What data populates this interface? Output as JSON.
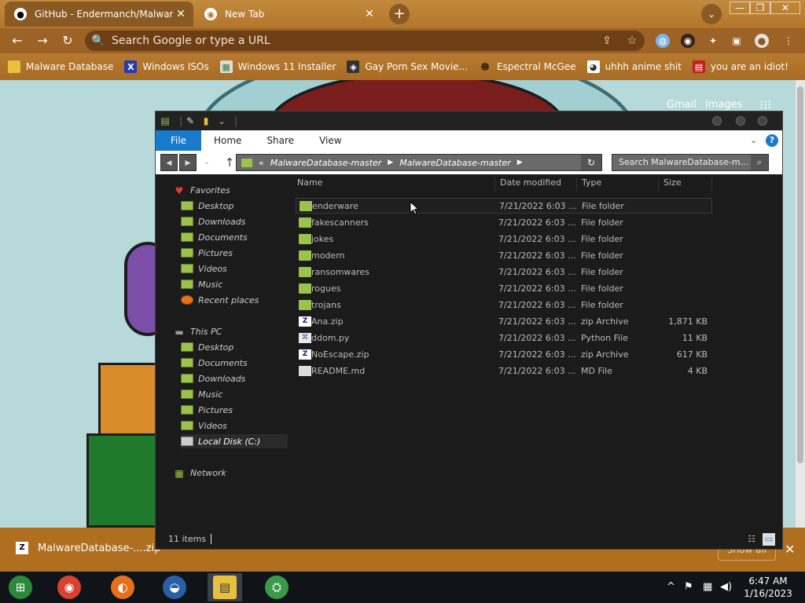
{
  "browser": {
    "tabs": [
      {
        "title": "GitHub - Endermanch/MalwareDa",
        "icon": "github-icon"
      },
      {
        "title": "New Tab",
        "icon": "chrome-icon"
      }
    ],
    "new_tab_label": "+",
    "tab_close": "✕",
    "search_tabs_icon": "⌄",
    "window_controls": {
      "minimize": "—",
      "restore": "❐",
      "close": "✕"
    },
    "nav": {
      "back": "←",
      "forward": "→",
      "reload": "↻"
    },
    "omnibox": {
      "placeholder": "Search Google or type a URL",
      "search_icon": "🔍",
      "share_icon": "⇪",
      "star_icon": "☆"
    },
    "extensions": {
      "ext1": "◍",
      "ext2": "◉",
      "puzzle": "✦",
      "sidebar": "▣",
      "profile": "●",
      "menu": "⋮"
    },
    "bookmarks": [
      {
        "label": "Malware Database",
        "icon": "folder-icon",
        "glyph": ""
      },
      {
        "label": "Windows ISOs",
        "icon": "x-icon",
        "glyph": "X"
      },
      {
        "label": "Windows 11 Installer",
        "icon": "image-icon",
        "glyph": "▦"
      },
      {
        "label": "Gay Porn Sex Movie...",
        "icon": "site-icon",
        "glyph": "◈"
      },
      {
        "label": "Espectral McGee",
        "icon": "face-icon",
        "glyph": "☻"
      },
      {
        "label": "uhhh anime shit",
        "icon": "anime-icon",
        "glyph": "◕"
      },
      {
        "label": "you are an idiot!",
        "icon": "flag-icon",
        "glyph": "▤"
      }
    ]
  },
  "newtab_page": {
    "gmail": "Gmail",
    "images": "Images",
    "apps_icon": "⁝⁝⁝"
  },
  "download_bar": {
    "file_icon": "Z",
    "filename": "MalwareDatabase-....zip",
    "menu_icon": "^",
    "show_all": "Show all",
    "close": "✕"
  },
  "explorer": {
    "quick_access": {
      "icon1": "▤",
      "icon2": "✎",
      "icon3": "▮",
      "icon4": "⌄",
      "icon5": "|"
    },
    "ribbon": {
      "file": "File",
      "home": "Home",
      "share": "Share",
      "view": "View",
      "chevron": "⌄",
      "help": "?"
    },
    "nav_buttons": {
      "back": "◀",
      "forward": "▶",
      "history": "⌄",
      "up": "↑"
    },
    "address": {
      "overflow": "«",
      "crumbs": [
        "MalwareDatabase-master",
        "MalwareDatabase-master"
      ],
      "separator": "▶",
      "refresh": "↻"
    },
    "search": {
      "placeholder": "Search MalwareDatabase-m...",
      "icon": "⌕"
    },
    "navpane": {
      "favorites": {
        "label": "Favorites",
        "icon": "♥",
        "items": [
          "Desktop",
          "Downloads",
          "Documents",
          "Pictures",
          "Videos",
          "Music",
          "Recent places"
        ]
      },
      "this_pc": {
        "label": "This PC",
        "icon": "▬",
        "items": [
          "Desktop",
          "Documents",
          "Downloads",
          "Music",
          "Pictures",
          "Videos",
          "Local Disk (C:)"
        ]
      },
      "network": {
        "label": "Network",
        "icon": "▦"
      }
    },
    "columns": {
      "name": "Name",
      "date": "Date modified",
      "type": "Type",
      "size": "Size"
    },
    "files": [
      {
        "name": "enderware",
        "date": "7/21/2022 6:03 ...",
        "type": "File folder",
        "size": "",
        "kind": "folder"
      },
      {
        "name": "fakescanners",
        "date": "7/21/2022 6:03 ...",
        "type": "File folder",
        "size": "",
        "kind": "folder"
      },
      {
        "name": "jokes",
        "date": "7/21/2022 6:03 ...",
        "type": "File folder",
        "size": "",
        "kind": "folder"
      },
      {
        "name": "modern",
        "date": "7/21/2022 6:03 ...",
        "type": "File folder",
        "size": "",
        "kind": "folder"
      },
      {
        "name": "ransomwares",
        "date": "7/21/2022 6:03 ...",
        "type": "File folder",
        "size": "",
        "kind": "folder"
      },
      {
        "name": "rogues",
        "date": "7/21/2022 6:03 ...",
        "type": "File folder",
        "size": "",
        "kind": "folder"
      },
      {
        "name": "trojans",
        "date": "7/21/2022 6:03 ...",
        "type": "File folder",
        "size": "",
        "kind": "folder"
      },
      {
        "name": "Ana.zip",
        "date": "7/21/2022 6:03 ...",
        "type": "zip Archive",
        "size": "1,871 KB",
        "kind": "zip"
      },
      {
        "name": "ddom.py",
        "date": "7/21/2022 6:03 ...",
        "type": "Python File",
        "size": "11 KB",
        "kind": "py"
      },
      {
        "name": "NoEscape.zip",
        "date": "7/21/2022 6:03 ...",
        "type": "zip Archive",
        "size": "617 KB",
        "kind": "zip"
      },
      {
        "name": "README.md",
        "date": "7/21/2022 6:03 ...",
        "type": "MD File",
        "size": "4 KB",
        "kind": "md"
      }
    ],
    "status": {
      "count": "11 items",
      "details_view": "☷",
      "large_icons_view": "▭"
    }
  },
  "taskbar": {
    "apps": [
      {
        "name": "start-orb",
        "glyph": "⊞",
        "color": "#2a8a3a"
      },
      {
        "name": "chrome",
        "glyph": "◉",
        "color": "#d8412f"
      },
      {
        "name": "firefox",
        "glyph": "◐",
        "color": "#e8701a"
      },
      {
        "name": "obama",
        "glyph": "◒",
        "color": "#2a5fa8"
      },
      {
        "name": "explorer",
        "glyph": "▤",
        "color": "#e8c040"
      },
      {
        "name": "network-app",
        "glyph": "⛭",
        "color": "#3a9a4a"
      }
    ],
    "tray": {
      "chevron": "^",
      "flag": "⚑",
      "network": "▦",
      "volume": "◀)"
    },
    "time": "6:47 AM",
    "date": "1/16/2023"
  },
  "colors": {
    "chrome_theme": "#b27629",
    "explorer_bg": "#1b1b1b",
    "ribbon_file": "#1979ca",
    "folder": "#9bc24a"
  }
}
